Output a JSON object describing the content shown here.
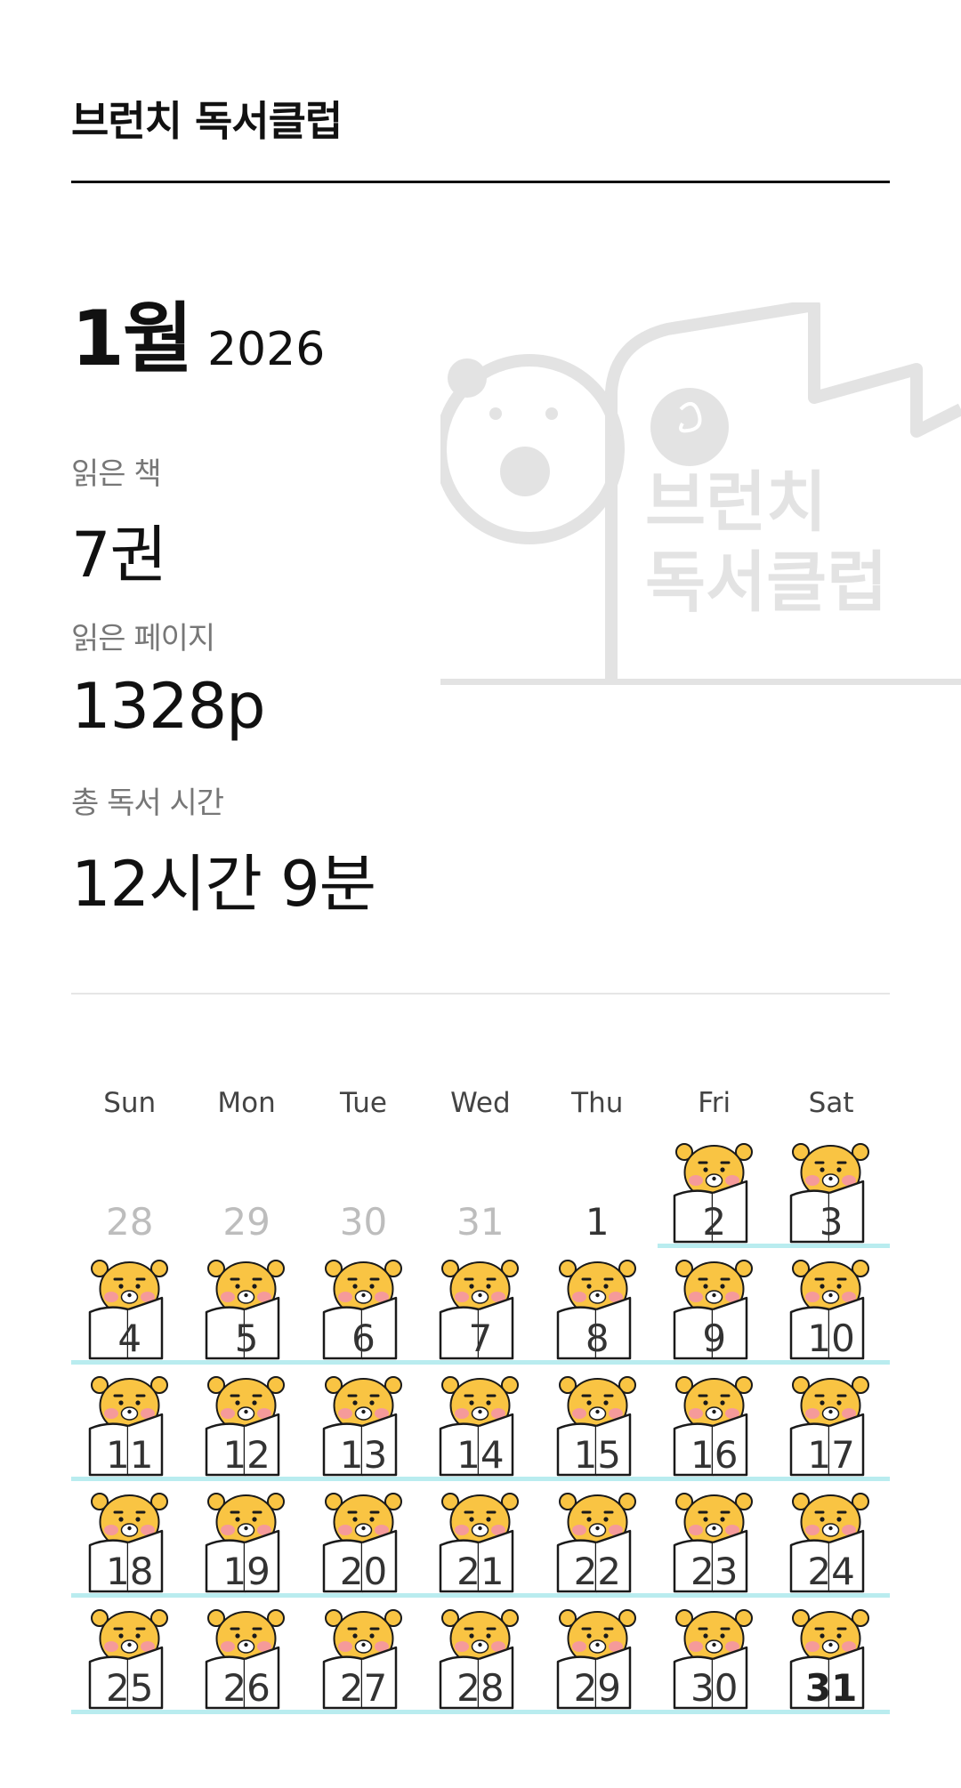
{
  "header": {
    "title": "브런치 독서클럽"
  },
  "period": {
    "month": "1월",
    "year": "2026"
  },
  "stats": {
    "books_label": "읽은 책",
    "books_value": "7권",
    "pages_label": "읽은 페이지",
    "pages_value": "1328p",
    "time_label": "총 독서 시간",
    "time_value": "12시간 9분"
  },
  "watermark": {
    "text_line1": "브런치",
    "text_line2": "독서클럽"
  },
  "calendar": {
    "weekdays": [
      "Sun",
      "Mon",
      "Tue",
      "Wed",
      "Thu",
      "Fri",
      "Sat"
    ],
    "weeks": [
      [
        {
          "day": "28",
          "state": "other-month",
          "read": false
        },
        {
          "day": "29",
          "state": "other-month",
          "read": false
        },
        {
          "day": "30",
          "state": "other-month",
          "read": false
        },
        {
          "day": "31",
          "state": "other-month",
          "read": false
        },
        {
          "day": "1",
          "state": "current",
          "read": false
        },
        {
          "day": "2",
          "state": "current",
          "read": true
        },
        {
          "day": "3",
          "state": "current",
          "read": true
        }
      ],
      [
        {
          "day": "4",
          "state": "current",
          "read": true
        },
        {
          "day": "5",
          "state": "current",
          "read": true
        },
        {
          "day": "6",
          "state": "current",
          "read": true
        },
        {
          "day": "7",
          "state": "current",
          "read": true
        },
        {
          "day": "8",
          "state": "current",
          "read": true
        },
        {
          "day": "9",
          "state": "current",
          "read": true
        },
        {
          "day": "10",
          "state": "current",
          "read": true
        }
      ],
      [
        {
          "day": "11",
          "state": "current",
          "read": true
        },
        {
          "day": "12",
          "state": "current",
          "read": true
        },
        {
          "day": "13",
          "state": "current",
          "read": true
        },
        {
          "day": "14",
          "state": "current",
          "read": true
        },
        {
          "day": "15",
          "state": "current",
          "read": true
        },
        {
          "day": "16",
          "state": "current",
          "read": true
        },
        {
          "day": "17",
          "state": "current",
          "read": true
        }
      ],
      [
        {
          "day": "18",
          "state": "current",
          "read": true
        },
        {
          "day": "19",
          "state": "current",
          "read": true
        },
        {
          "day": "20",
          "state": "current",
          "read": true
        },
        {
          "day": "21",
          "state": "current",
          "read": true
        },
        {
          "day": "22",
          "state": "current",
          "read": true
        },
        {
          "day": "23",
          "state": "current",
          "read": true
        },
        {
          "day": "24",
          "state": "current",
          "read": true
        }
      ],
      [
        {
          "day": "25",
          "state": "current",
          "read": true
        },
        {
          "day": "26",
          "state": "current",
          "read": true
        },
        {
          "day": "27",
          "state": "current",
          "read": true
        },
        {
          "day": "28",
          "state": "current",
          "read": true
        },
        {
          "day": "29",
          "state": "current",
          "read": true
        },
        {
          "day": "30",
          "state": "current",
          "read": true
        },
        {
          "day": "31",
          "state": "today",
          "read": true
        }
      ]
    ]
  },
  "colors": {
    "underline": "#b9ecef",
    "character_face": "#f9c443",
    "character_cheek": "#f59a9a",
    "watermark": "#e3e3e3"
  },
  "icons": {
    "reading_stamp": "ryan-reading-icon"
  }
}
